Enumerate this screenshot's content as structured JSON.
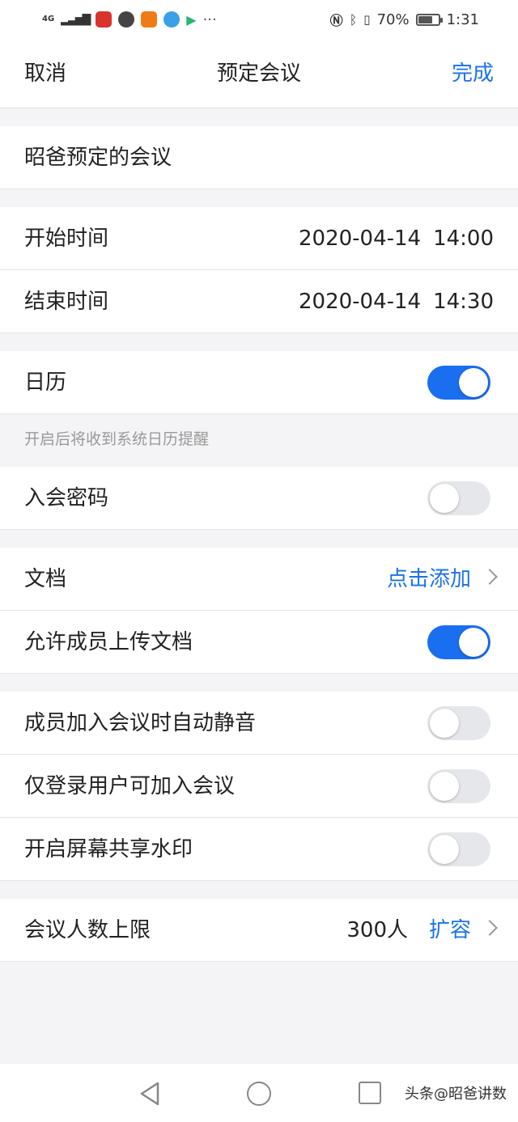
{
  "status_bar": {
    "network": "4G",
    "more": "···",
    "battery_text": "70%",
    "battery_level": 0.7,
    "time": "1:31",
    "icons": [
      "nfc-icon",
      "bluetooth-icon",
      "vibrate-icon"
    ]
  },
  "nav": {
    "cancel": "取消",
    "title": "预定会议",
    "done": "完成"
  },
  "meeting_name": "昭爸预定的会议",
  "start": {
    "label": "开始时间",
    "date": "2020-04-14",
    "time": "14:00"
  },
  "end": {
    "label": "结束时间",
    "date": "2020-04-14",
    "time": "14:30"
  },
  "calendar": {
    "label": "日历",
    "on": true,
    "hint": "开启后将收到系统日历提醒"
  },
  "password": {
    "label": "入会密码",
    "on": false
  },
  "document": {
    "label": "文档",
    "action": "点击添加"
  },
  "allow_upload": {
    "label": "允许成员上传文档",
    "on": true
  },
  "auto_mute": {
    "label": "成员加入会议时自动静音",
    "on": false
  },
  "login_only": {
    "label": "仅登录用户可加入会议",
    "on": false
  },
  "watermark_share": {
    "label": "开启屏幕共享水印",
    "on": false
  },
  "capacity": {
    "label": "会议人数上限",
    "value": "300人",
    "action": "扩容"
  },
  "colors": {
    "accent": "#1a73e8",
    "toggle_on": "#1a6ff0",
    "toggle_off": "#e6e7eb",
    "background": "#f4f4f6"
  },
  "source_watermark": "头条@昭爸讲数"
}
